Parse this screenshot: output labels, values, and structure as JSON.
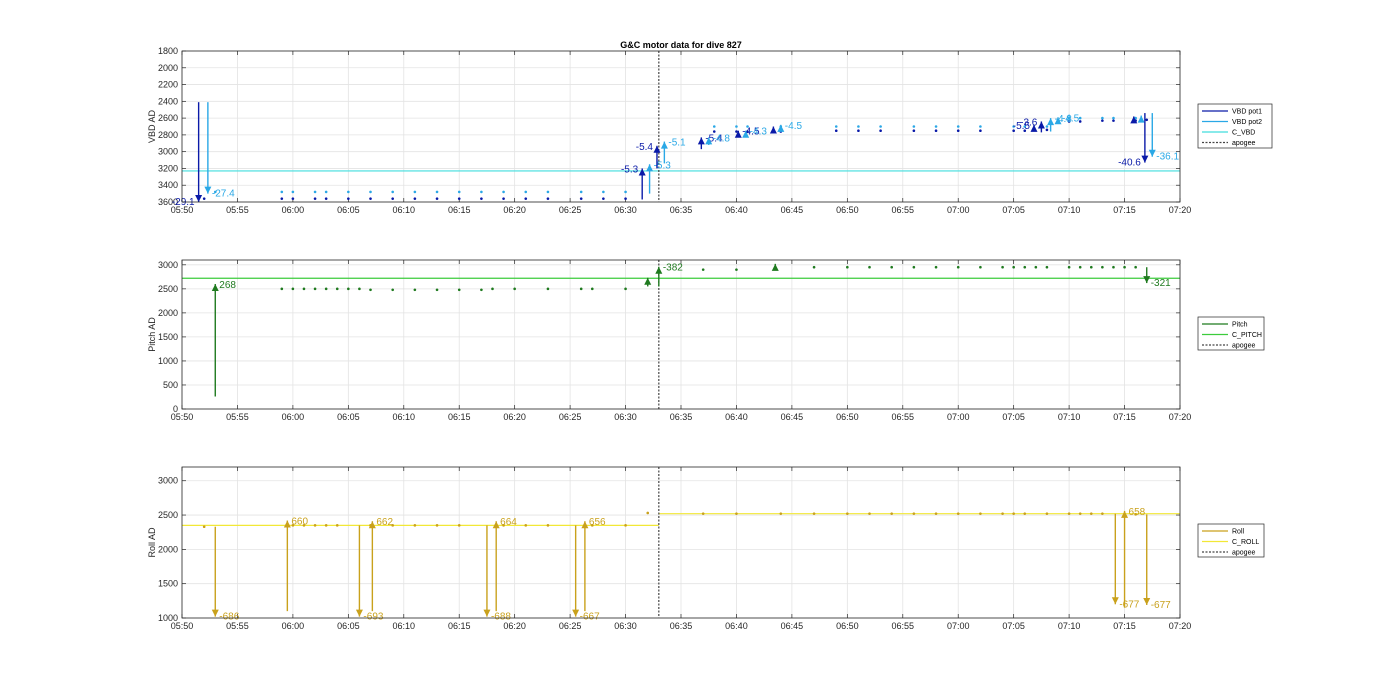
{
  "figure": {
    "title": "G&C motor data for dive 827"
  },
  "chart_data": [
    {
      "type": "scatter",
      "id": "vbd",
      "title": "G&C motor data for dive 827",
      "ylabel": "VBD AD",
      "xlabel": "",
      "y_reversed": true,
      "ylim": [
        1800,
        3600
      ],
      "yticks": [
        1800,
        2000,
        2200,
        2400,
        2600,
        2800,
        3000,
        3200,
        3400,
        3600
      ],
      "xlim": [
        "05:50",
        "07:20"
      ],
      "xticks": [
        "05:50",
        "05:55",
        "06:00",
        "06:05",
        "06:10",
        "06:15",
        "06:20",
        "06:25",
        "06:30",
        "06:35",
        "06:40",
        "06:45",
        "06:50",
        "06:55",
        "07:00",
        "07:05",
        "07:10",
        "07:15",
        "07:20"
      ],
      "grid": true,
      "legend_position": "outside-right",
      "legend": [
        "VBD pot1",
        "VBD pot2",
        "C_VBD",
        "apogee"
      ],
      "colors": {
        "pot1": "#0a1aa8",
        "pot2": "#2aa8e6",
        "c_line": "#40dede",
        "apogee": "#444444"
      },
      "c_value": 3230,
      "apogee_x": "06:33",
      "series": [
        {
          "name": "VBD pot1",
          "x": [
            "05:52",
            "05:59",
            "06:00",
            "06:02",
            "06:03",
            "06:05",
            "06:07",
            "06:09",
            "06:11",
            "06:13",
            "06:15",
            "06:17",
            "06:19",
            "06:21",
            "06:23",
            "06:26",
            "06:28",
            "06:30",
            "06:38",
            "06:40",
            "06:41",
            "06:44",
            "06:49",
            "06:51",
            "06:53",
            "06:56",
            "06:58",
            "07:00",
            "07:02",
            "07:05",
            "07:06",
            "07:08",
            "07:10",
            "07:11",
            "07:13",
            "07:14",
            "07:16",
            "07:17"
          ],
          "values": [
            3560,
            3560,
            3560,
            3560,
            3560,
            3560,
            3560,
            3560,
            3560,
            3560,
            3560,
            3560,
            3560,
            3560,
            3560,
            3560,
            3560,
            3560,
            2760,
            2760,
            2760,
            2760,
            2750,
            2750,
            2750,
            2750,
            2750,
            2750,
            2750,
            2750,
            2750,
            2740,
            2640,
            2640,
            2630,
            2630,
            2630,
            2620
          ]
        },
        {
          "name": "VBD pot2",
          "x": [
            "05:53",
            "05:59",
            "06:00",
            "06:02",
            "06:03",
            "06:05",
            "06:07",
            "06:09",
            "06:11",
            "06:13",
            "06:15",
            "06:17",
            "06:19",
            "06:21",
            "06:23",
            "06:26",
            "06:28",
            "06:30",
            "06:38",
            "06:40",
            "06:41",
            "06:44",
            "06:49",
            "06:51",
            "06:53",
            "06:56",
            "06:58",
            "07:00",
            "07:02",
            "07:05",
            "07:06",
            "07:08",
            "07:10",
            "07:11",
            "07:13",
            "07:14",
            "07:16"
          ],
          "values": [
            3480,
            3480,
            3480,
            3480,
            3480,
            3480,
            3480,
            3480,
            3480,
            3480,
            3480,
            3480,
            3480,
            3480,
            3480,
            3480,
            3480,
            3480,
            2700,
            2700,
            2700,
            2700,
            2700,
            2700,
            2700,
            2700,
            2700,
            2700,
            2700,
            2700,
            2700,
            2700,
            2600,
            2600,
            2600,
            2600,
            2600
          ]
        }
      ],
      "arrows": [
        {
          "series": "pot1",
          "x": "05:51:30",
          "from": 2410,
          "to": 3610,
          "label": "-29.1",
          "label_side": "left"
        },
        {
          "series": "pot2",
          "x": "05:52:20",
          "from": 2410,
          "to": 3500,
          "label": "-27.4",
          "label_side": "right"
        },
        {
          "series": "pot1",
          "x": "06:31:30",
          "from": 3570,
          "to": 3200,
          "label": "-5.3",
          "label_side": "left"
        },
        {
          "series": "pot2",
          "x": "06:32:10",
          "from": 3500,
          "to": 3150,
          "label": "-5.3",
          "label_side": "right"
        },
        {
          "series": "pot1",
          "x": "06:32:50",
          "from": 3200,
          "to": 2930,
          "label": "-5.4",
          "label_side": "left"
        },
        {
          "series": "pot2",
          "x": "06:33:30",
          "from": 3140,
          "to": 2880,
          "label": "-5.1",
          "label_side": "right"
        },
        {
          "series": "pot1",
          "x": "06:36:50",
          "from": 2970,
          "to": 2830,
          "label": "-5.4",
          "label_side": "right"
        },
        {
          "series": "pot2",
          "x": "06:37:30",
          "from": 2920,
          "to": 2830,
          "label": "-4.8",
          "label_side": "right"
        },
        {
          "series": "pot1",
          "x": "06:40:10",
          "from": 2830,
          "to": 2750,
          "label": "-4.5",
          "label_side": "right"
        },
        {
          "series": "pot2",
          "x": "06:40:50",
          "from": 2800,
          "to": 2750,
          "label": "-4.3",
          "label_side": "right"
        },
        {
          "series": "pot1",
          "x": "06:43:20",
          "from": 2760,
          "to": 2700,
          "label": "",
          "label_side": "right"
        },
        {
          "series": "pot2",
          "x": "06:44:00",
          "from": 2720,
          "to": 2680,
          "label": "-4.5",
          "label_side": "right"
        },
        {
          "series": "pot1",
          "x": "07:06:50",
          "from": 2760,
          "to": 2680,
          "label": "-5.5",
          "label_side": "left"
        },
        {
          "series": "pot1",
          "x": "07:07:30",
          "from": 2770,
          "to": 2640,
          "label": "-3.6",
          "label_side": "left"
        },
        {
          "series": "pot2",
          "x": "07:08:20",
          "from": 2760,
          "to": 2600,
          "label": "-4.8",
          "label_side": "right"
        },
        {
          "series": "pot2",
          "x": "07:09:00",
          "from": 2640,
          "to": 2590,
          "label": "-4.5",
          "label_side": "right"
        },
        {
          "series": "pot1",
          "x": "07:15:50",
          "from": 2640,
          "to": 2580,
          "label": "",
          "label_side": "left"
        },
        {
          "series": "pot2",
          "x": "07:16:30",
          "from": 2620,
          "to": 2570,
          "label": "",
          "label_side": "left"
        },
        {
          "series": "pot1",
          "x": "07:16:50",
          "from": 2540,
          "to": 3130,
          "label": "-40.6",
          "label_side": "left"
        },
        {
          "series": "pot2",
          "x": "07:17:30",
          "from": 2540,
          "to": 3060,
          "label": "-36.1",
          "label_side": "right"
        }
      ]
    },
    {
      "type": "scatter",
      "id": "pitch",
      "title": "",
      "ylabel": "Pitch AD",
      "xlabel": "",
      "y_reversed": false,
      "ylim": [
        0,
        3100
      ],
      "yticks": [
        0,
        500,
        1000,
        1500,
        2000,
        2500,
        3000
      ],
      "xlim": [
        "05:50",
        "07:20"
      ],
      "xticks": [
        "05:50",
        "05:55",
        "06:00",
        "06:05",
        "06:10",
        "06:15",
        "06:20",
        "06:25",
        "06:30",
        "06:35",
        "06:40",
        "06:45",
        "06:50",
        "06:55",
        "07:00",
        "07:05",
        "07:10",
        "07:15",
        "07:20"
      ],
      "grid": true,
      "legend_position": "outside-right",
      "legend": [
        "Pitch",
        "C_PITCH",
        "apogee"
      ],
      "colors": {
        "main": "#1f7a1f",
        "c_line": "#3ccc3c",
        "apogee": "#444444"
      },
      "c_value": 2720,
      "apogee_x": "06:33",
      "series": [
        {
          "name": "Pitch",
          "x": [
            "05:59",
            "06:00",
            "06:01",
            "06:02",
            "06:03",
            "06:04",
            "06:05",
            "06:06",
            "06:07",
            "06:09",
            "06:11",
            "06:13",
            "06:15",
            "06:17",
            "06:18",
            "06:20",
            "06:23",
            "06:26",
            "06:27",
            "06:30",
            "06:37",
            "06:40",
            "06:47",
            "06:50",
            "06:52",
            "06:54",
            "06:56",
            "06:58",
            "07:00",
            "07:02",
            "07:04",
            "07:05",
            "07:06",
            "07:07",
            "07:08",
            "07:10",
            "07:11",
            "07:12",
            "07:13",
            "07:14",
            "07:15",
            "07:16"
          ],
          "values": [
            2500,
            2500,
            2500,
            2500,
            2500,
            2500,
            2500,
            2500,
            2480,
            2480,
            2480,
            2480,
            2480,
            2480,
            2500,
            2500,
            2500,
            2500,
            2500,
            2500,
            2900,
            2900,
            2950,
            2950,
            2950,
            2950,
            2950,
            2950,
            2950,
            2950,
            2950,
            2950,
            2950,
            2950,
            2950,
            2950,
            2950,
            2950,
            2950,
            2950,
            2950,
            2950
          ]
        }
      ],
      "arrows": [
        {
          "series": "main",
          "x": "05:53",
          "from": 260,
          "to": 2600,
          "label": "268",
          "label_side": "right"
        },
        {
          "series": "main",
          "x": "06:32",
          "from": 2550,
          "to": 2730,
          "label": "",
          "label_side": "right"
        },
        {
          "series": "main",
          "x": "06:33",
          "from": 2550,
          "to": 2960,
          "label": "-382",
          "label_side": "right"
        },
        {
          "series": "main",
          "x": "06:43:30",
          "from": 2910,
          "to": 3020,
          "label": "",
          "label_side": "right"
        },
        {
          "series": "main",
          "x": "07:17",
          "from": 2950,
          "to": 2620,
          "label": "-321",
          "label_side": "right"
        }
      ]
    },
    {
      "type": "scatter",
      "id": "roll",
      "title": "",
      "ylabel": "Roll AD",
      "xlabel": "",
      "y_reversed": false,
      "ylim": [
        1000,
        3200
      ],
      "yticks": [
        1000,
        1500,
        2000,
        2500,
        3000
      ],
      "xlim": [
        "05:50",
        "07:20"
      ],
      "xticks": [
        "05:50",
        "05:55",
        "06:00",
        "06:05",
        "06:10",
        "06:15",
        "06:20",
        "06:25",
        "06:30",
        "06:35",
        "06:40",
        "06:45",
        "06:50",
        "06:55",
        "07:00",
        "07:05",
        "07:10",
        "07:15",
        "07:20"
      ],
      "grid": true,
      "legend_position": "outside-right",
      "legend": [
        "Roll",
        "C_ROLL",
        "apogee"
      ],
      "colors": {
        "main": "#c9a11c",
        "c_line": "#f2e836",
        "apogee": "#444444"
      },
      "c_segments": [
        {
          "from": "05:50",
          "to": "06:33",
          "value": 2350
        },
        {
          "from": "06:33",
          "to": "07:20",
          "value": 2520
        }
      ],
      "apogee_x": "06:33",
      "series": [
        {
          "name": "Roll",
          "x": [
            "05:52",
            "06:00",
            "06:01",
            "06:02",
            "06:03",
            "06:04",
            "06:07",
            "06:09",
            "06:11",
            "06:13",
            "06:15",
            "06:19",
            "06:21",
            "06:23",
            "06:27",
            "06:30",
            "06:32",
            "06:37",
            "06:40",
            "06:44",
            "06:47",
            "06:50",
            "06:52",
            "06:54",
            "06:56",
            "06:58",
            "07:00",
            "07:02",
            "07:04",
            "07:05",
            "07:06",
            "07:08",
            "07:10",
            "07:11",
            "07:12",
            "07:13",
            "07:16"
          ],
          "values": [
            2330,
            2350,
            2350,
            2350,
            2350,
            2350,
            2350,
            2350,
            2350,
            2350,
            2350,
            2350,
            2350,
            2350,
            2350,
            2350,
            2530,
            2520,
            2520,
            2520,
            2520,
            2520,
            2520,
            2520,
            2520,
            2520,
            2520,
            2520,
            2520,
            2520,
            2520,
            2520,
            2520,
            2520,
            2520,
            2520,
            2510
          ]
        }
      ],
      "arrows": [
        {
          "series": "main",
          "x": "05:53",
          "from": 2330,
          "to": 1020,
          "label": "-686",
          "label_side": "right"
        },
        {
          "series": "main",
          "x": "05:59:30",
          "from": 1100,
          "to": 2420,
          "label": "660",
          "label_side": "right"
        },
        {
          "series": "main",
          "x": "06:06",
          "from": 2350,
          "to": 1020,
          "label": "-693",
          "label_side": "right"
        },
        {
          "series": "main",
          "x": "06:07:10",
          "from": 1100,
          "to": 2410,
          "label": "662",
          "label_side": "right"
        },
        {
          "series": "main",
          "x": "06:17:30",
          "from": 2350,
          "to": 1020,
          "label": "-688",
          "label_side": "right"
        },
        {
          "series": "main",
          "x": "06:18:20",
          "from": 1100,
          "to": 2410,
          "label": "664",
          "label_side": "right"
        },
        {
          "series": "main",
          "x": "06:25:30",
          "from": 2350,
          "to": 1020,
          "label": "-667",
          "label_side": "right"
        },
        {
          "series": "main",
          "x": "06:26:20",
          "from": 1100,
          "to": 2410,
          "label": "656",
          "label_side": "right"
        },
        {
          "series": "main",
          "x": "07:14:10",
          "from": 2520,
          "to": 1200,
          "label": "-677",
          "label_side": "right"
        },
        {
          "series": "main",
          "x": "07:15",
          "from": 1150,
          "to": 2560,
          "label": "658",
          "label_side": "right"
        },
        {
          "series": "main",
          "x": "07:17",
          "from": 2510,
          "to": 1190,
          "label": "-677",
          "label_side": "right"
        }
      ]
    }
  ]
}
